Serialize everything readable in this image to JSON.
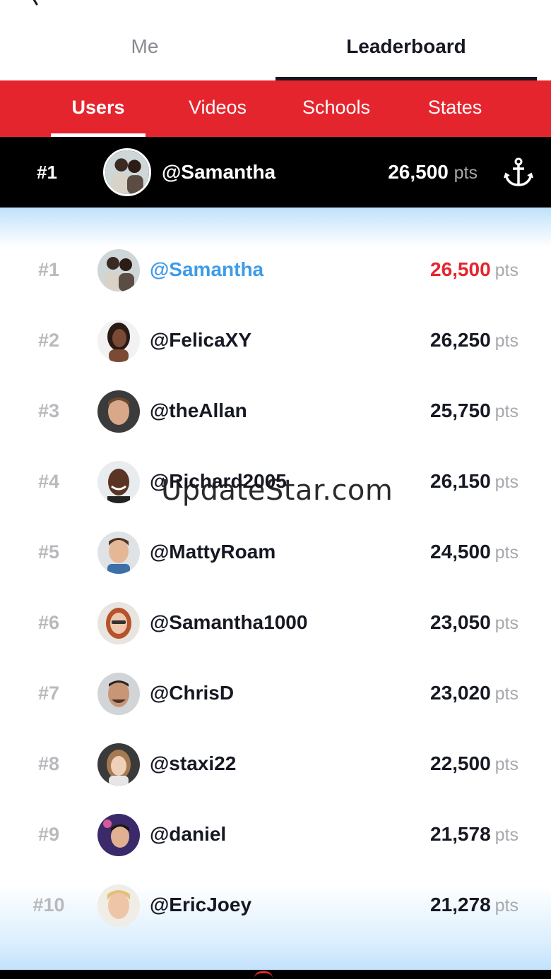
{
  "header": {
    "tabs": [
      {
        "label": "Me",
        "active": false
      },
      {
        "label": "Leaderboard",
        "active": true
      }
    ]
  },
  "subtabs": {
    "items": [
      {
        "label": "Users",
        "active": true
      },
      {
        "label": "Videos",
        "active": false
      },
      {
        "label": "Schools",
        "active": false
      },
      {
        "label": "States",
        "active": false
      }
    ]
  },
  "current_user": {
    "rank": "#1",
    "username": "@Samantha",
    "points": "26,500",
    "unit": "pts",
    "icon": "anchor-icon"
  },
  "leaderboard": [
    {
      "rank": "#1",
      "username": "@Samantha",
      "points": "26,500",
      "unit": "pts",
      "highlight": true
    },
    {
      "rank": "#2",
      "username": "@FelicaXY",
      "points": "26,250",
      "unit": "pts"
    },
    {
      "rank": "#3",
      "username": "@theAllan",
      "points": "25,750",
      "unit": "pts"
    },
    {
      "rank": "#4",
      "username": "@Richard2005",
      "points": "26,150",
      "unit": "pts"
    },
    {
      "rank": "#5",
      "username": "@MattyRoam",
      "points": "24,500",
      "unit": "pts"
    },
    {
      "rank": "#6",
      "username": "@Samantha1000",
      "points": "23,050",
      "unit": "pts"
    },
    {
      "rank": "#7",
      "username": "@ChrisD",
      "points": "23,020",
      "unit": "pts"
    },
    {
      "rank": "#8",
      "username": "@staxi22",
      "points": "22,500",
      "unit": "pts"
    },
    {
      "rank": "#9",
      "username": "@daniel",
      "points": "21,578",
      "unit": "pts"
    },
    {
      "rank": "#10",
      "username": "@EricJoey",
      "points": "21,278",
      "unit": "pts"
    }
  ],
  "watermark": "UpdateStar.com",
  "colors": {
    "accent_red": "#e5252e",
    "highlight_blue": "#3d9be9",
    "rank_gray": "#b9b9be"
  }
}
